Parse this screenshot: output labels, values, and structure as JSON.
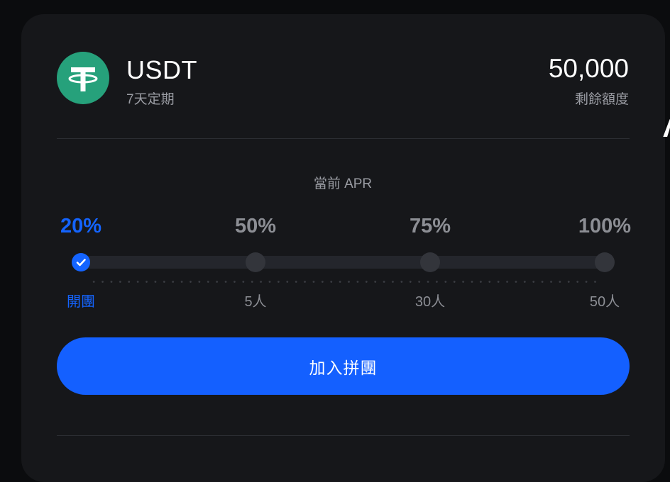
{
  "coin": {
    "name": "USDT",
    "term": "7天定期",
    "remaining_value": "50,000",
    "remaining_label": "剩餘額度"
  },
  "apr": {
    "title": "當前 APR",
    "tiers": [
      {
        "percent": "20%",
        "level": "開團",
        "active": true
      },
      {
        "percent": "50%",
        "level": "5人",
        "active": false
      },
      {
        "percent": "75%",
        "level": "30人",
        "active": false
      },
      {
        "percent": "100%",
        "level": "50人",
        "active": false
      }
    ]
  },
  "actions": {
    "join_label": "加入拼團"
  },
  "colors": {
    "accent": "#1464ff",
    "tether_green": "#26a17b",
    "card_bg": "#16171a",
    "muted_text": "#9a9ca3"
  },
  "icons": {
    "logo": "tether-logo-icon",
    "active_dot": "check-icon"
  }
}
